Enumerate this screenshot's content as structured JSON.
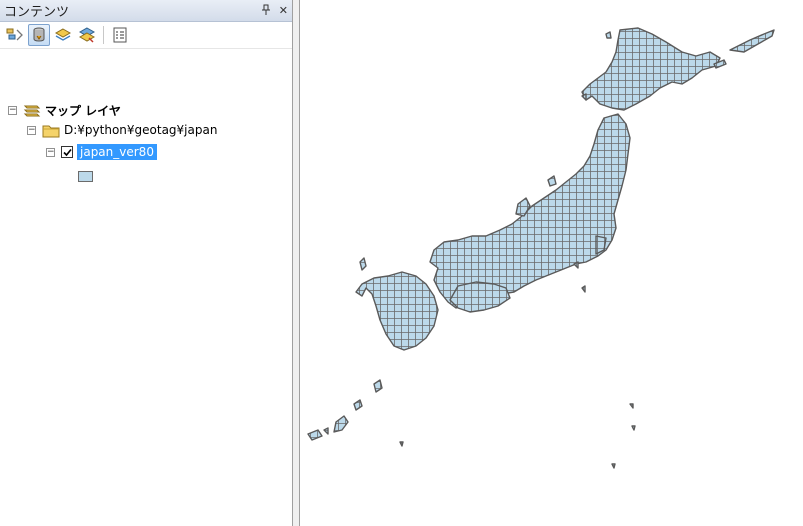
{
  "toc": {
    "title": "コンテンツ",
    "pin_glyph": "ꟷ",
    "close_glyph": "✕",
    "toolbar": {
      "buttons": [
        {
          "name": "list-by-drawing-order-icon",
          "active": false
        },
        {
          "name": "list-by-source-icon",
          "active": true
        },
        {
          "name": "list-by-visibility-icon",
          "active": false
        },
        {
          "name": "list-by-selection-icon",
          "active": false
        },
        {
          "name": "options-icon",
          "active": false
        }
      ]
    },
    "tree": {
      "map_label": "マップ レイヤ",
      "folder_label": "D:¥python¥geotag¥japan",
      "layer_label": "japan_ver80",
      "layer_checked": true,
      "expander_glyph": "−"
    },
    "colors": {
      "selection": "#3399ff",
      "polygon_fill": "#bcd9ea",
      "polygon_outline": "#5a5a5a"
    }
  },
  "map": {
    "layer": "japan_ver80"
  }
}
